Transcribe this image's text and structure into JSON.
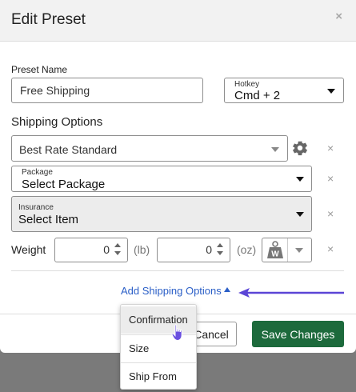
{
  "modal": {
    "title": "Edit Preset",
    "close_glyph": "×"
  },
  "preset_name": {
    "label": "Preset Name",
    "value": "Free Shipping"
  },
  "hotkey": {
    "label": "Hotkey",
    "value": "Cmd + 2"
  },
  "shipping_options": {
    "heading": "Shipping Options",
    "service": {
      "value": "Best Rate Standard"
    },
    "package": {
      "label": "Package",
      "value": "Select Package"
    },
    "insurance": {
      "label": "Insurance",
      "value": "Select Item"
    },
    "remove_glyph": "×"
  },
  "weight": {
    "label": "Weight",
    "lb_value": "0",
    "lb_unit": "(lb)",
    "oz_value": "0",
    "oz_unit": "(oz)",
    "scale_letter": "W"
  },
  "add_shipping_options": {
    "label": "Add Shipping Options"
  },
  "dropdown_menu": {
    "items": [
      "Confirmation",
      "Size",
      "Ship From"
    ],
    "hovered_index": 0
  },
  "footer": {
    "cancel_label": "Cancel",
    "save_label": "Save Changes"
  },
  "colors": {
    "link": "#2b5fc7",
    "primary_button": "#1d6a3c",
    "annotation_arrow": "#5b45d6",
    "backdrop": "#7a7a7a"
  },
  "icons": [
    "gear-icon",
    "scale-icon",
    "close-icon",
    "caret-down-icon",
    "caret-up-icon",
    "pointer-hand-icon",
    "arrow-left-icon"
  ]
}
